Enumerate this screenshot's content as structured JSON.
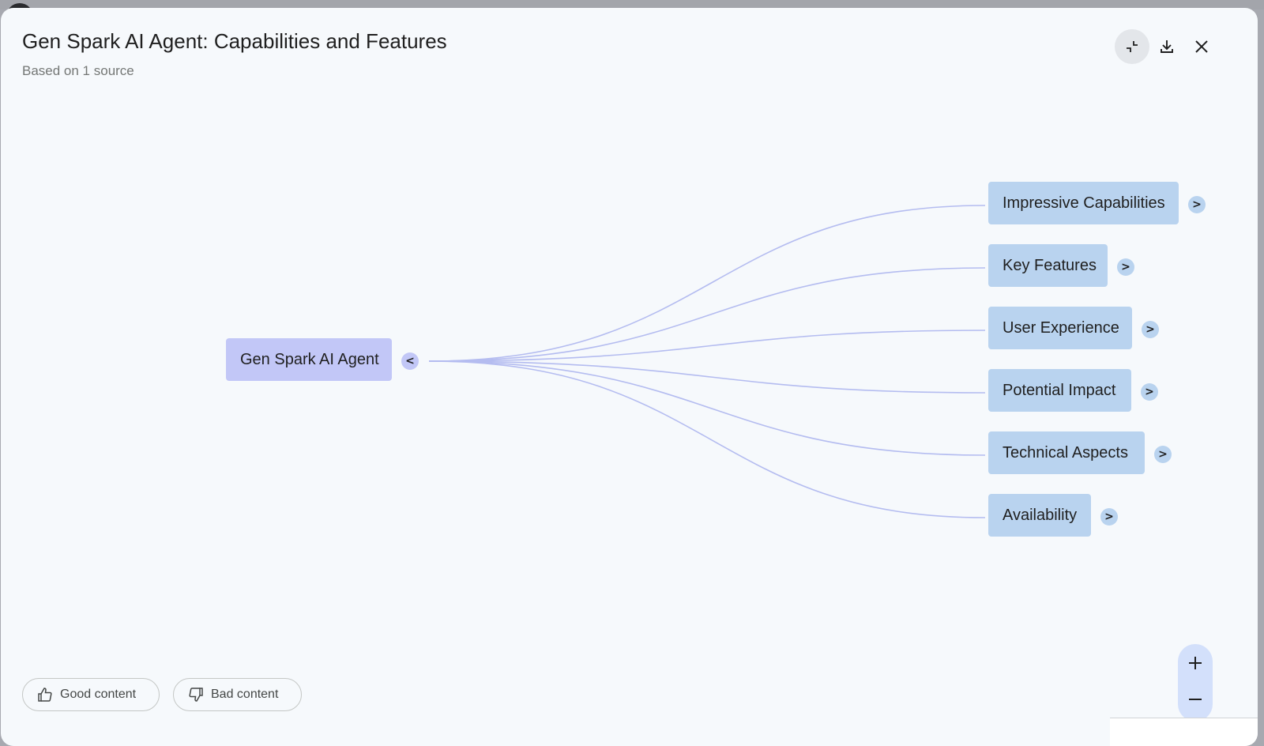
{
  "dialog": {
    "title": "Gen Spark AI Agent: Capabilities and Features",
    "subtitle": "Based on 1 source"
  },
  "header_actions": {
    "collapse_icon": "collapse-fullscreen-icon",
    "download_icon": "download-icon",
    "close_icon": "close-icon"
  },
  "mindmap": {
    "root": {
      "label": "Gen Spark AI Agent",
      "toggle": "<"
    },
    "children": [
      {
        "label": "Impressive Capabilities",
        "toggle": ">"
      },
      {
        "label": "Key Features",
        "toggle": ">"
      },
      {
        "label": "User Experience",
        "toggle": ">"
      },
      {
        "label": "Potential Impact",
        "toggle": ">"
      },
      {
        "label": "Technical Aspects",
        "toggle": ">"
      },
      {
        "label": "Availability",
        "toggle": ">"
      }
    ],
    "colors": {
      "root_fill": "#c2c7f7",
      "child_fill": "#b9d3ef",
      "connector": "#b4bcf0"
    }
  },
  "feedback": {
    "good_label": "Good content",
    "bad_label": "Bad content",
    "good_icon": "thumbs-up-icon",
    "bad_icon": "thumbs-down-icon"
  },
  "zoom": {
    "in_icon": "plus-icon",
    "out_icon": "minus-icon"
  }
}
